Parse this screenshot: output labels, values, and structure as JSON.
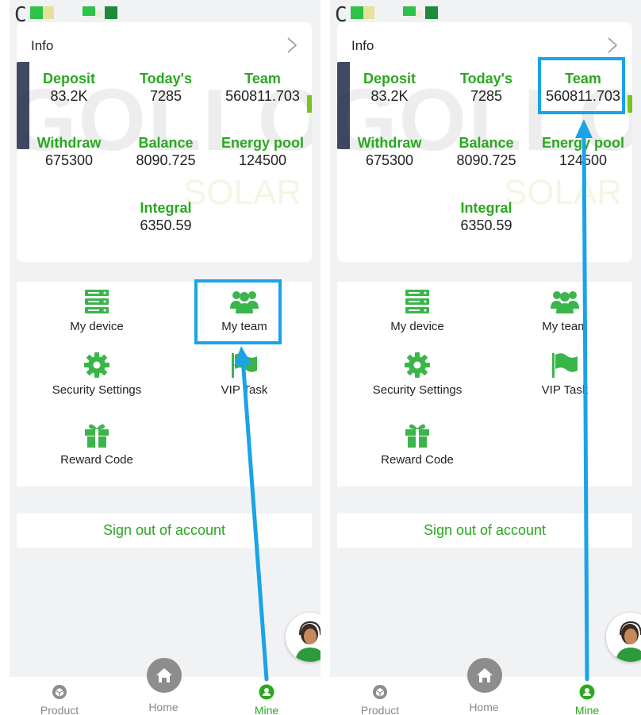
{
  "colors": {
    "accent_green": "#2aa820",
    "highlight_blue": "#1aa3e8",
    "background": "#f1f2f4"
  },
  "panels": [
    {
      "info": {
        "title": "Info",
        "stats": [
          {
            "label": "Deposit",
            "value": "83.2K"
          },
          {
            "label": "Today's",
            "value": "7285"
          },
          {
            "label": "Team",
            "value": "560811.703"
          },
          {
            "label": "Withdraw",
            "value": "675300"
          },
          {
            "label": "Balance",
            "value": "8090.725"
          },
          {
            "label": "Energy pool",
            "value": "124500"
          },
          {
            "label": "Integral",
            "value": "6350.59"
          }
        ]
      },
      "menu": [
        {
          "label": "My device",
          "icon": "server-icon"
        },
        {
          "label": "My team",
          "icon": "team-icon"
        },
        {
          "label": "Security Settings",
          "icon": "gear-icon"
        },
        {
          "label": "VIP Task",
          "icon": "flag-icon"
        },
        {
          "label": "Reward Code",
          "icon": "gift-icon"
        }
      ],
      "signout": "Sign out of account",
      "tabs": [
        {
          "label": "Product",
          "icon": "product-icon"
        },
        {
          "label": "Home",
          "icon": "home-icon"
        },
        {
          "label": "Mine",
          "icon": "user-icon"
        }
      ],
      "header_letter": "C",
      "watermark": {
        "brand": "GOLLONG",
        "sub": "SOLAR"
      }
    },
    {
      "info": {
        "title": "Info",
        "stats": [
          {
            "label": "Deposit",
            "value": "83.2K"
          },
          {
            "label": "Today's",
            "value": "7285"
          },
          {
            "label": "Team",
            "value": "560811.703"
          },
          {
            "label": "Withdraw",
            "value": "675300"
          },
          {
            "label": "Balance",
            "value": "8090.725"
          },
          {
            "label": "Energy pool",
            "value": "124500"
          },
          {
            "label": "Integral",
            "value": "6350.59"
          }
        ]
      },
      "menu": [
        {
          "label": "My device",
          "icon": "server-icon"
        },
        {
          "label": "My team",
          "icon": "team-icon"
        },
        {
          "label": "Security Settings",
          "icon": "gear-icon"
        },
        {
          "label": "VIP Task",
          "icon": "flag-icon"
        },
        {
          "label": "Reward Code",
          "icon": "gift-icon"
        }
      ],
      "signout": "Sign out of account",
      "tabs": [
        {
          "label": "Product",
          "icon": "product-icon"
        },
        {
          "label": "Home",
          "icon": "home-icon"
        },
        {
          "label": "Mine",
          "icon": "user-icon"
        }
      ],
      "header_letter": "C",
      "watermark": {
        "brand": "GOLLONG",
        "sub": "SOLAR"
      }
    }
  ]
}
